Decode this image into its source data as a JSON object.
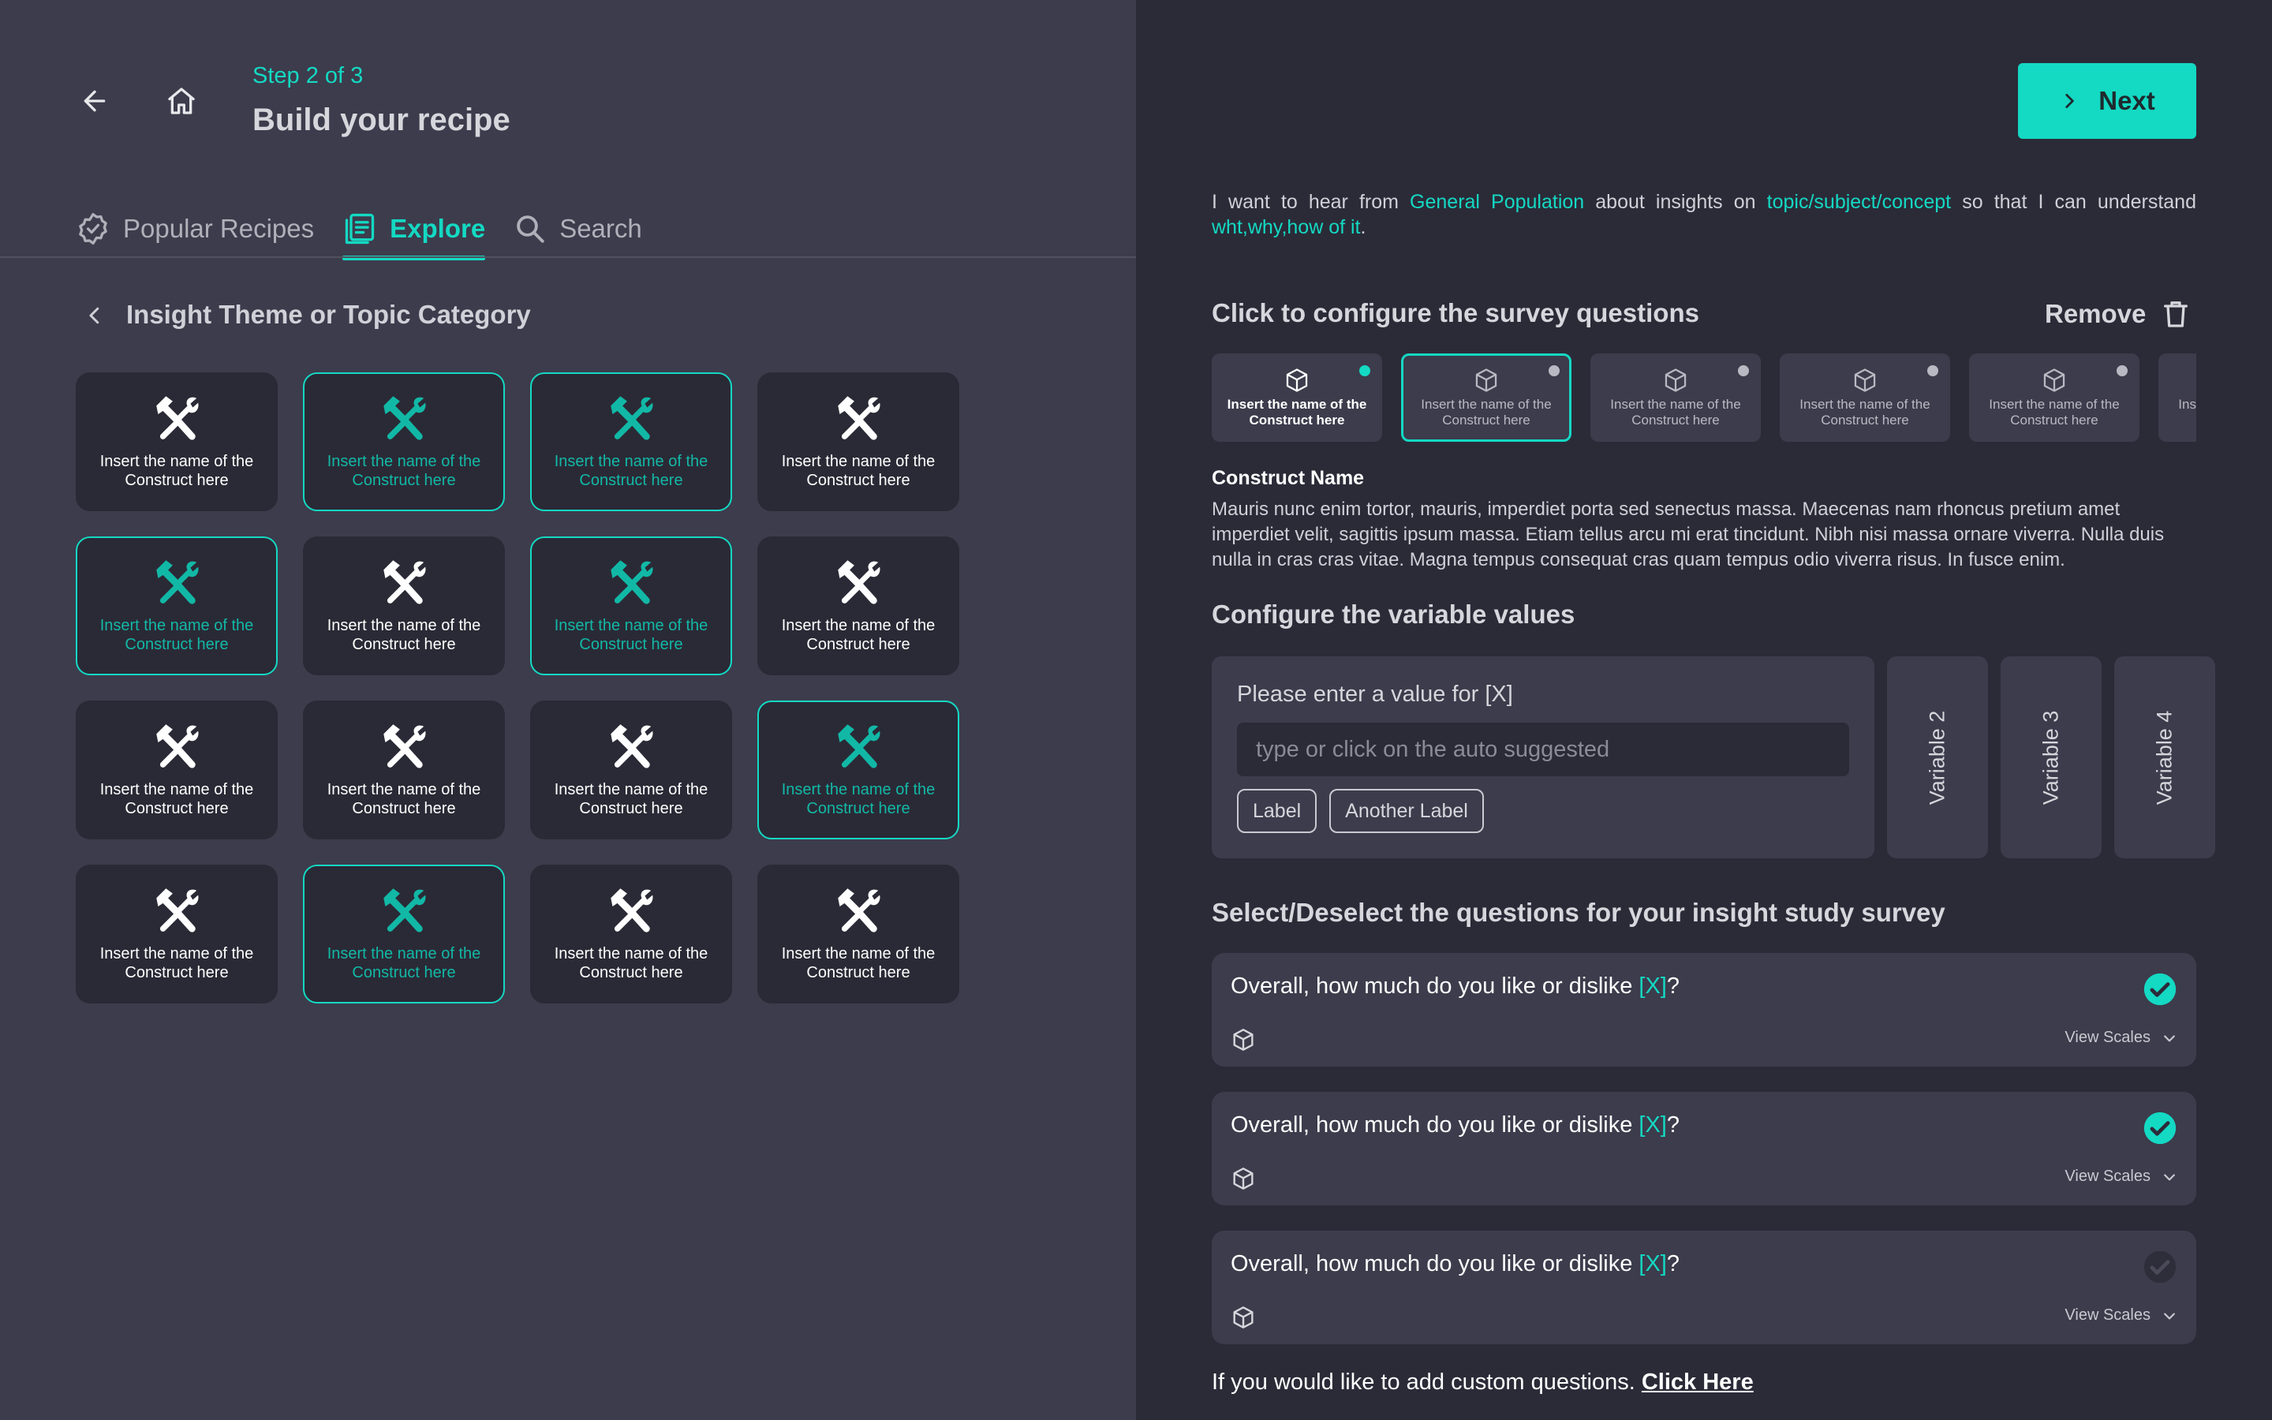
{
  "colors": {
    "accent": "#14d9c3",
    "panel_left": "#3c3c4c",
    "panel_right": "#2b2b38",
    "card": "#2a2a36"
  },
  "header": {
    "back_icon": "arrow-left-icon",
    "home_icon": "home-icon",
    "step": "Step 2 of 3",
    "title": "Build your recipe"
  },
  "tabs": [
    {
      "label": "Popular Recipes",
      "icon": "badge-check-icon",
      "active": false
    },
    {
      "label": "Explore",
      "icon": "list-icon",
      "active": true
    },
    {
      "label": "Search",
      "icon": "search-icon",
      "active": false
    }
  ],
  "category": {
    "title": "Insight Theme or Topic Category"
  },
  "grid": {
    "items": [
      {
        "label": "Insert the name of the Construct here",
        "selected": false
      },
      {
        "label": "Insert the name of the Construct here",
        "selected": true
      },
      {
        "label": "Insert the name of the Construct here",
        "selected": true
      },
      {
        "label": "Insert the name of the Construct here",
        "selected": false
      },
      {
        "label": "Insert the name of the Construct here",
        "selected": true
      },
      {
        "label": "Insert the name of the Construct here",
        "selected": false
      },
      {
        "label": "Insert the name of the Construct here",
        "selected": true
      },
      {
        "label": "Insert the name of the Construct here",
        "selected": false
      },
      {
        "label": "Insert the name of the Construct here",
        "selected": false
      },
      {
        "label": "Insert the name of the Construct here",
        "selected": false
      },
      {
        "label": "Insert the name of the Construct here",
        "selected": false
      },
      {
        "label": "Insert the name of the Construct here",
        "selected": true
      },
      {
        "label": "Insert the name of the Construct here",
        "selected": false
      },
      {
        "label": "Insert the name of the Construct here",
        "selected": true
      },
      {
        "label": "Insert the name of the Construct here",
        "selected": false
      },
      {
        "label": "Insert the name of the Construct here",
        "selected": false
      }
    ]
  },
  "right": {
    "next_label": "Next",
    "sentence": {
      "p1": "I want to hear from ",
      "audience": "General Population",
      "p2": " about insights on ",
      "topic": "topic/subject/concept",
      "p3": " so that I can understand ",
      "goal": "wht,why,how of it",
      "p4": "."
    },
    "configure_title": "Click to configure the survey questions",
    "remove_label": "Remove",
    "constructs": [
      {
        "label": "Insert the name of the Construct here",
        "bold": true,
        "dot": "on",
        "active": false
      },
      {
        "label": "Insert the name of the Construct here",
        "bold": false,
        "dot": "off",
        "active": true
      },
      {
        "label": "Insert the name of the Construct here",
        "bold": false,
        "dot": "off",
        "active": false
      },
      {
        "label": "Insert the name of the Construct here",
        "bold": false,
        "dot": "off",
        "active": false
      },
      {
        "label": "Insert the name of the Construct here",
        "bold": false,
        "dot": "off",
        "active": false
      },
      {
        "label": "Insert the name of the Construct here",
        "bold": false,
        "dot": "none",
        "active": false
      }
    ],
    "construct_name": "Construct Name",
    "construct_desc": "Mauris nunc enim tortor, mauris, imperdiet porta sed senectus massa. Maecenas nam rhoncus pretium amet imperdiet velit, sagittis ipsum massa. Etiam tellus arcu mi erat tincidunt. Nibh nisi massa ornare viverra. Nulla duis nulla in cras cras vitae. Magna tempus consequat cras quam tempus odio viverra risus. In fusce enim.",
    "variables_title": "Configure the variable values",
    "variable_prompt": "Please enter a value for [X]",
    "variable_placeholder": "type or click on the auto suggested",
    "variable_chips": [
      "Label",
      "Another Label"
    ],
    "variable_tabs": [
      "Variable 2",
      "Variable 3",
      "Variable 4"
    ],
    "questions_title": "Select/Deselect the questions for your insight study survey",
    "questions": [
      {
        "pre": "Overall, how much do you like or dislike ",
        "var": "[X]",
        "post": "?",
        "checked": true,
        "scales": "View Scales"
      },
      {
        "pre": "Overall, how much do you like or dislike ",
        "var": "[X]",
        "post": "?",
        "checked": true,
        "scales": "View Scales"
      },
      {
        "pre": "Overall, how much do you like or dislike ",
        "var": "[X]",
        "post": "?",
        "checked": false,
        "scales": "View Scales"
      }
    ],
    "custom_text": "If you would like to add custom questions. ",
    "custom_link": "Click Here"
  }
}
